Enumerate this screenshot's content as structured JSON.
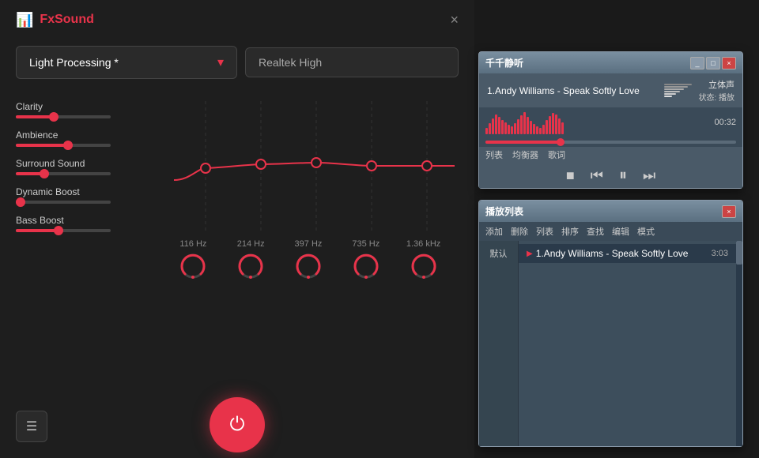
{
  "app": {
    "name": "FxSound",
    "close_label": "×"
  },
  "preset": {
    "label": "Light Processing *",
    "chevron": "▾"
  },
  "output": {
    "label": "Realtek High"
  },
  "controls": [
    {
      "id": "clarity",
      "label": "Clarity",
      "fill_pct": 40,
      "thumb_pct": 40
    },
    {
      "id": "ambience",
      "label": "Ambience",
      "fill_pct": 55,
      "thumb_pct": 55
    },
    {
      "id": "surround",
      "label": "Surround Sound",
      "fill_pct": 30,
      "thumb_pct": 30
    },
    {
      "id": "dynamic",
      "label": "Dynamic Boost",
      "fill_pct": 5,
      "thumb_pct": 5
    },
    {
      "id": "bass",
      "label": "Bass Boost",
      "fill_pct": 45,
      "thumb_pct": 45
    }
  ],
  "eq": {
    "bands": [
      {
        "freq": "116 Hz",
        "value": 0.45
      },
      {
        "freq": "214 Hz",
        "value": 0.52
      },
      {
        "freq": "397 Hz",
        "value": 0.55
      },
      {
        "freq": "735 Hz",
        "value": 0.5
      },
      {
        "freq": "1.36 kHz",
        "value": 0.52
      }
    ]
  },
  "menu_btn": "☰",
  "power_btn": "⏻",
  "player": {
    "title": "千千静听",
    "song": "1.Andy Williams - Speak Softly Love",
    "mode_label": "立体声",
    "status_label": "状态: 播放",
    "time": "00:32",
    "menu_items": [
      "列表",
      "均衡器",
      "歌词"
    ],
    "controls": {
      "stop": "■",
      "prev": "⏮",
      "play_pause": "⏸",
      "next": "⏭"
    },
    "waveform_heights": [
      8,
      14,
      20,
      25,
      22,
      18,
      15,
      12,
      10,
      14,
      19,
      24,
      28,
      22,
      17,
      13,
      10,
      8,
      12,
      18,
      23,
      27,
      25,
      20,
      15
    ],
    "progress_pct": 30
  },
  "playlist": {
    "title": "播放列表",
    "close_label": "×",
    "menu_items": [
      "添加",
      "删除",
      "列表",
      "排序",
      "查找",
      "编辑",
      "模式"
    ],
    "category": "默认",
    "tracks": [
      {
        "id": 1,
        "name": "Andy Williams - Speak Softly Love",
        "duration": "3:03",
        "active": true
      }
    ]
  }
}
